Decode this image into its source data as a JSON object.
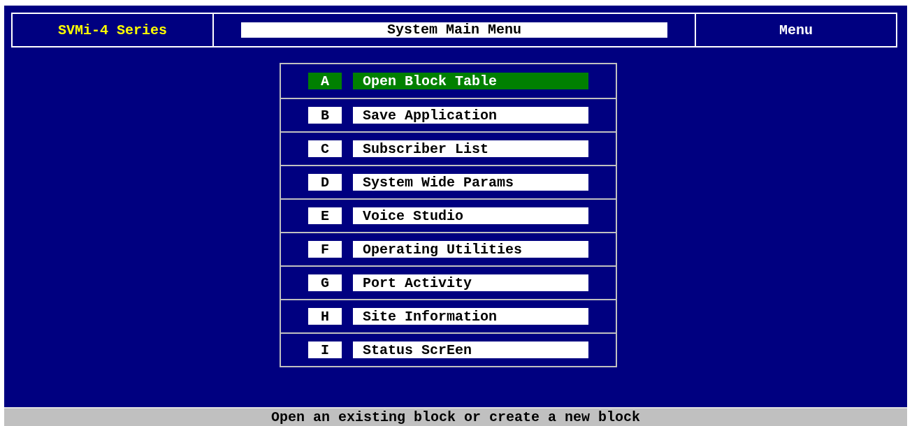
{
  "header": {
    "product": "SVMi-4 Series",
    "title": "System Main Menu",
    "mode": "Menu"
  },
  "menu": {
    "items": [
      {
        "key": "A",
        "label": "Open Block Table",
        "selected": true
      },
      {
        "key": "B",
        "label": "Save Application",
        "selected": false
      },
      {
        "key": "C",
        "label": "Subscriber List",
        "selected": false
      },
      {
        "key": "D",
        "label": "System Wide Params",
        "selected": false
      },
      {
        "key": "E",
        "label": "Voice Studio",
        "selected": false
      },
      {
        "key": "F",
        "label": "Operating Utilities",
        "selected": false
      },
      {
        "key": "G",
        "label": "Port Activity",
        "selected": false
      },
      {
        "key": "H",
        "label": "Site Information",
        "selected": false
      },
      {
        "key": "I",
        "label": "Status ScrEen",
        "selected": false
      }
    ]
  },
  "status_bar": "Open an existing block or create a new block"
}
